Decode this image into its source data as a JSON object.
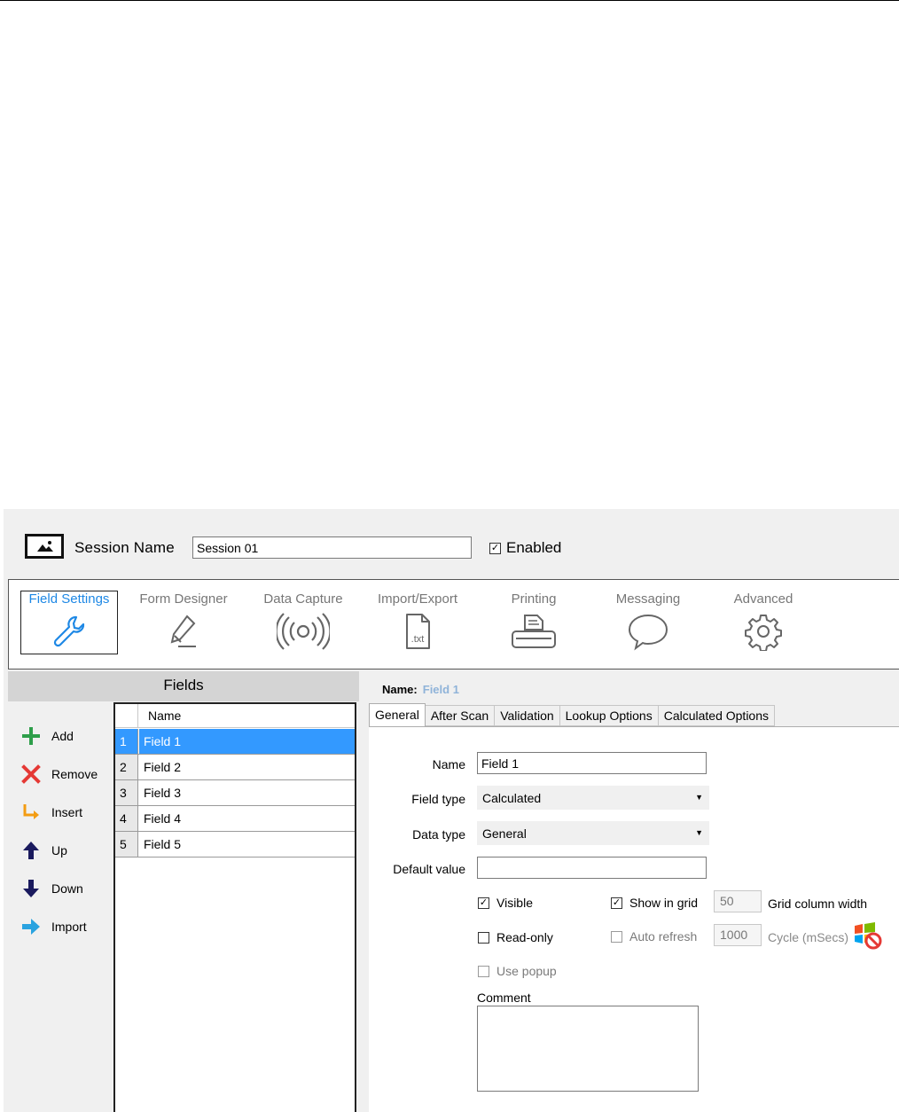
{
  "session": {
    "label": "Session Name",
    "value": "Session 01",
    "enabled_label": "Enabled",
    "enabled_checked": true
  },
  "ribbon": {
    "items": [
      {
        "label": "Field Settings",
        "icon": "wrench-icon",
        "active": true
      },
      {
        "label": "Form Designer",
        "icon": "pencil-icon"
      },
      {
        "label": "Data Capture",
        "icon": "broadcast-icon"
      },
      {
        "label": "Import/Export",
        "icon": "txt-file-icon",
        "icon_text": ".txt"
      },
      {
        "label": "Printing",
        "icon": "printer-icon"
      },
      {
        "label": "Messaging",
        "icon": "speech-bubble-icon"
      },
      {
        "label": "Advanced",
        "icon": "gear-icon"
      }
    ]
  },
  "fields_panel": {
    "title": "Fields",
    "actions": [
      {
        "label": "Add",
        "icon": "plus-icon",
        "color": "#2e9e4a"
      },
      {
        "label": "Remove",
        "icon": "x-icon",
        "color": "#e53935"
      },
      {
        "label": "Insert",
        "icon": "insert-arrow-icon",
        "color": "#f39c12"
      },
      {
        "label": "Up",
        "icon": "arrow-up-icon",
        "color": "#1a1a5e"
      },
      {
        "label": "Down",
        "icon": "arrow-down-icon",
        "color": "#1a1a5e"
      },
      {
        "label": "Import",
        "icon": "arrow-right-icon",
        "color": "#2aa3e0"
      }
    ],
    "grid": {
      "column_header": "Name",
      "rows": [
        {
          "num": "1",
          "name": "Field 1",
          "selected": true
        },
        {
          "num": "2",
          "name": "Field 2"
        },
        {
          "num": "3",
          "name": "Field 3"
        },
        {
          "num": "4",
          "name": "Field 4"
        },
        {
          "num": "5",
          "name": "Field 5"
        }
      ]
    }
  },
  "details": {
    "name_label": "Name:",
    "name_value": "Field 1",
    "tabs": [
      "General",
      "After Scan",
      "Validation",
      "Lookup Options",
      "Calculated Options"
    ],
    "active_tab": "General",
    "general": {
      "name_label": "Name",
      "name_value": "Field 1",
      "field_type_label": "Field type",
      "field_type_value": "Calculated",
      "data_type_label": "Data type",
      "data_type_value": "General",
      "default_value_label": "Default value",
      "default_value": "",
      "visible_label": "Visible",
      "visible_checked": true,
      "show_in_grid_label": "Show in grid",
      "show_in_grid_checked": true,
      "grid_column_width_value": "50",
      "grid_column_width_label": "Grid column width",
      "readonly_label": "Read-only",
      "readonly_checked": false,
      "auto_refresh_label": "Auto refresh",
      "auto_refresh_checked": false,
      "cycle_value": "1000",
      "cycle_label": "Cycle (mSecs)",
      "use_popup_label": "Use popup",
      "use_popup_checked": false,
      "comment_label": "Comment",
      "comment_value": ""
    }
  },
  "colors": {
    "accent": "#1e88e5",
    "selection": "#3399ff",
    "panel_bg": "#f0f0f0",
    "header_bg": "#d4d4d4"
  }
}
